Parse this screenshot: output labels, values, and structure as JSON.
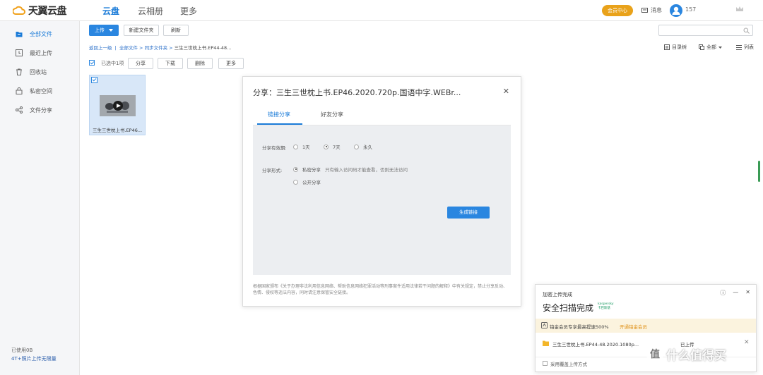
{
  "app": {
    "name": "天翼云盘",
    "accent": "#2a86e0"
  },
  "nav": {
    "tabs": [
      "云盘",
      "云相册",
      "更多"
    ],
    "vip_label": "会员中心",
    "message_label": "消息",
    "username": "157"
  },
  "sidebar": {
    "items": [
      {
        "label": "全部文件",
        "icon": "folder-icon"
      },
      {
        "label": "最近上传",
        "icon": "clock-icon"
      },
      {
        "label": "回收站",
        "icon": "trash-icon"
      },
      {
        "label": "私密空间",
        "icon": "lock-icon"
      },
      {
        "label": "文件分享",
        "icon": "share-icon"
      }
    ],
    "used": "已使用0B",
    "promo": "4T+照片上传无限量"
  },
  "toolbar": {
    "upload": "上传",
    "new_folder": "新建文件夹",
    "refresh": "刷新",
    "search_placeholder": ""
  },
  "breadcrumb": {
    "back": "返回上一级",
    "all": "全部文件",
    "sync": "同步文件夹",
    "current": "三生三世枕上书.EP44-48..."
  },
  "view": {
    "tree": "目录树",
    "all": "全部",
    "list": "列表"
  },
  "selection": {
    "text": "已选中1项",
    "share": "分享",
    "download": "下载",
    "delete": "删除",
    "more": "更多"
  },
  "file": {
    "name": "三生三世枕上书.EP46..."
  },
  "share_dialog": {
    "title": "分享：三生三世枕上书.EP46.2020.720p.国语中字.WEBr...",
    "tabs": [
      "链接分享",
      "好友分享"
    ],
    "validity_label": "分享有效期:",
    "validity_options": [
      "1天",
      "7天",
      "永久"
    ],
    "validity_selected": "7天",
    "form_label": "分享形式:",
    "form_private": "私密分享",
    "form_private_hint": "只有输入访问码才能查看，否则无法访问",
    "form_public": "公开分享",
    "generate": "生成链接",
    "disclaimer": "根据国家颁布《关于办理非法利用信息网络、帮助信息网络犯罪活动等刑事案件适用法律若干问题的解释》中有关规定，禁止分享反动、色情、侵权等违法内容，同时请注意保管安全链接。"
  },
  "upload_panel": {
    "title": "加密上传完成",
    "scan": "安全扫描完成",
    "kaspersky": "kaspersky\n卡巴斯基",
    "promo": "铂金会员专享最高提速500%",
    "promo_link": "开通铂金会员",
    "file_name": "三生三世枕上书.EP44-48.2020.1080p...",
    "file_status": "已上传",
    "cover_option": "采用覆盖上传方式"
  },
  "watermark": {
    "badge": "值",
    "text": "什么值得买"
  }
}
